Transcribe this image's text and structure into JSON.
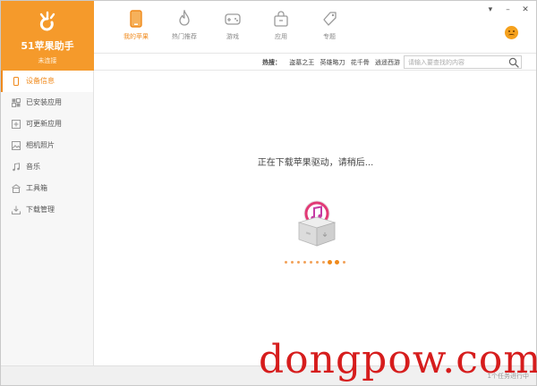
{
  "app": {
    "title": "51苹果助手",
    "connection_status": "未连接",
    "brand_color": "#f59a2b",
    "accent_color": "#f08a1c"
  },
  "window_controls": [
    {
      "name": "menu",
      "glyph": "▾"
    },
    {
      "name": "minimize",
      "glyph": "–"
    },
    {
      "name": "close",
      "glyph": "✕"
    }
  ],
  "nav_tabs": [
    {
      "label": "我的苹果",
      "icon": "phone-icon",
      "active": true
    },
    {
      "label": "热门推荐",
      "icon": "flame-icon",
      "active": false
    },
    {
      "label": "游戏",
      "icon": "gamepad-icon",
      "active": false
    },
    {
      "label": "应用",
      "icon": "shopping-bag-icon",
      "active": false
    },
    {
      "label": "专题",
      "icon": "tag-icon",
      "active": false
    }
  ],
  "search": {
    "hot_label": "热搜：",
    "hot_items": [
      "盗墓之王",
      "英雄略刀",
      "花千骨",
      "逍遥西游"
    ],
    "placeholder": "请输入要查找的内容",
    "icon": "search-icon"
  },
  "sidebar": {
    "items": [
      {
        "label": "设备信息",
        "icon": "device-icon",
        "active": true
      },
      {
        "label": "已安装应用",
        "icon": "apps-icon",
        "active": false
      },
      {
        "label": "可更新应用",
        "icon": "update-icon",
        "active": false
      },
      {
        "label": "相机照片",
        "icon": "photo-icon",
        "active": false
      },
      {
        "label": "音乐",
        "icon": "music-icon",
        "active": false
      },
      {
        "label": "工具箱",
        "icon": "toolbox-icon",
        "active": false
      },
      {
        "label": "下载管理",
        "icon": "download-icon",
        "active": false
      }
    ]
  },
  "main": {
    "status_message": "正在下载苹果驱动，请稍后..."
  },
  "footer": {
    "tasks_text": "1个任务进行中"
  },
  "watermark": "dongpow.com"
}
